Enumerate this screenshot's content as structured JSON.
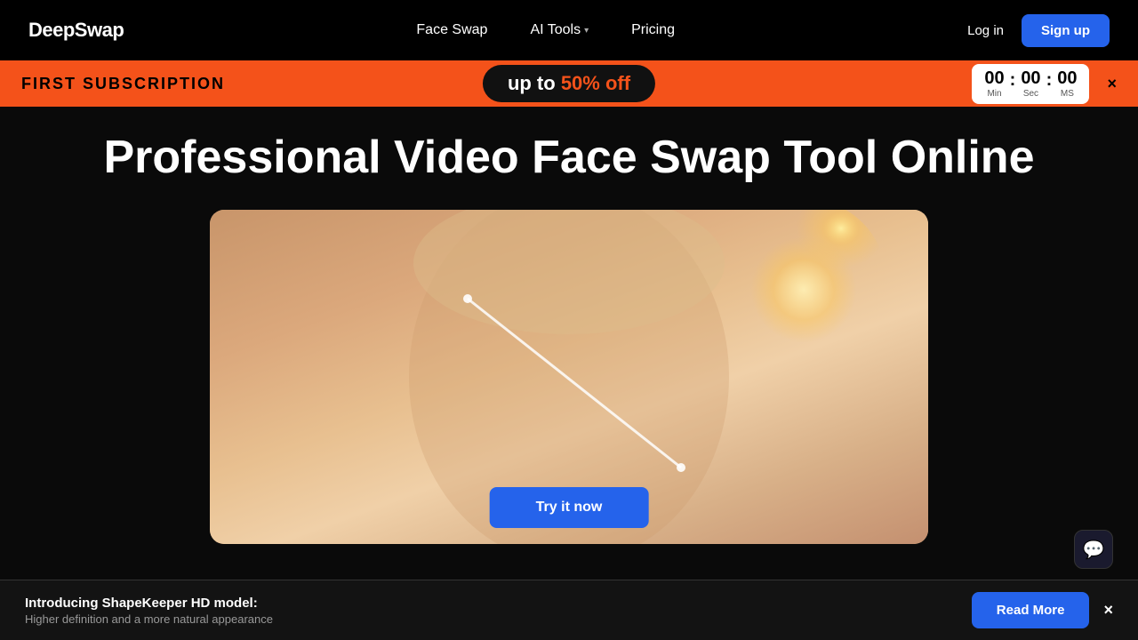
{
  "brand": {
    "name": "DeepSwap"
  },
  "navbar": {
    "links": [
      {
        "id": "face-swap",
        "label": "Face Swap",
        "hasDropdown": false
      },
      {
        "id": "ai-tools",
        "label": "AI Tools",
        "hasDropdown": true
      },
      {
        "id": "pricing",
        "label": "Pricing",
        "hasDropdown": false
      }
    ],
    "login_label": "Log in",
    "signup_label": "Sign up"
  },
  "promo_banner": {
    "left_text": "FIRST SUBSCRIPTION",
    "pill_text_prefix": "up to ",
    "pill_highlight": "50% off",
    "countdown": {
      "min": "00",
      "sec": "00",
      "ms": "00",
      "min_label": "Min",
      "sec_label": "Sec",
      "ms_label": "MS"
    },
    "close_label": "×"
  },
  "hero": {
    "title": "Professional Video Face Swap Tool Online"
  },
  "video": {
    "try_button_label": "Try it now"
  },
  "notification": {
    "title_bold": "Introducing ShapeKeeper HD model:",
    "subtitle": "Higher definition and a more natural appearance",
    "read_more_label": "Read More",
    "close_label": "×"
  },
  "chat": {
    "icon": "💬"
  }
}
